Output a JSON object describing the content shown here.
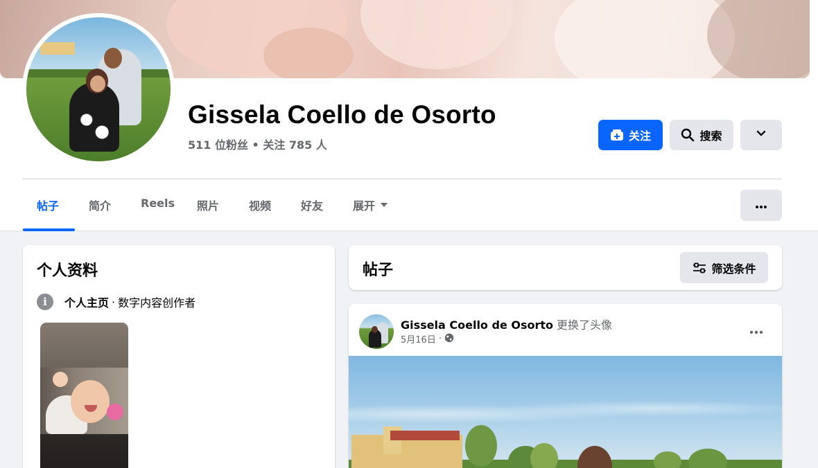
{
  "profile": {
    "name": "Gissela Coello de Osorto",
    "stats": "511 位粉丝 • 关注 785 人"
  },
  "actions": {
    "follow_label": "关注",
    "search_label": "搜索"
  },
  "tabs": [
    {
      "label": "帖子",
      "active": true
    },
    {
      "label": "简介"
    },
    {
      "label": "Reels"
    },
    {
      "label": "照片"
    },
    {
      "label": "视频"
    },
    {
      "label": "好友"
    },
    {
      "label": "展开"
    }
  ],
  "intro": {
    "title": "个人资料",
    "category_label": "个人主页",
    "separator": "·",
    "category_value": "数字内容创作者"
  },
  "posts": {
    "title": "帖子",
    "filter_label": "筛选条件"
  },
  "post": {
    "author": "Gissela Coello de Osorto",
    "action": "更换了头像",
    "date": "5月16日",
    "separator": "·",
    "audience_icon": "globe-icon"
  },
  "colors": {
    "accent": "#0866ff",
    "secondary_button": "#e4e6eb",
    "page_background": "#f0f2f5",
    "secondary_text": "#65676b"
  }
}
